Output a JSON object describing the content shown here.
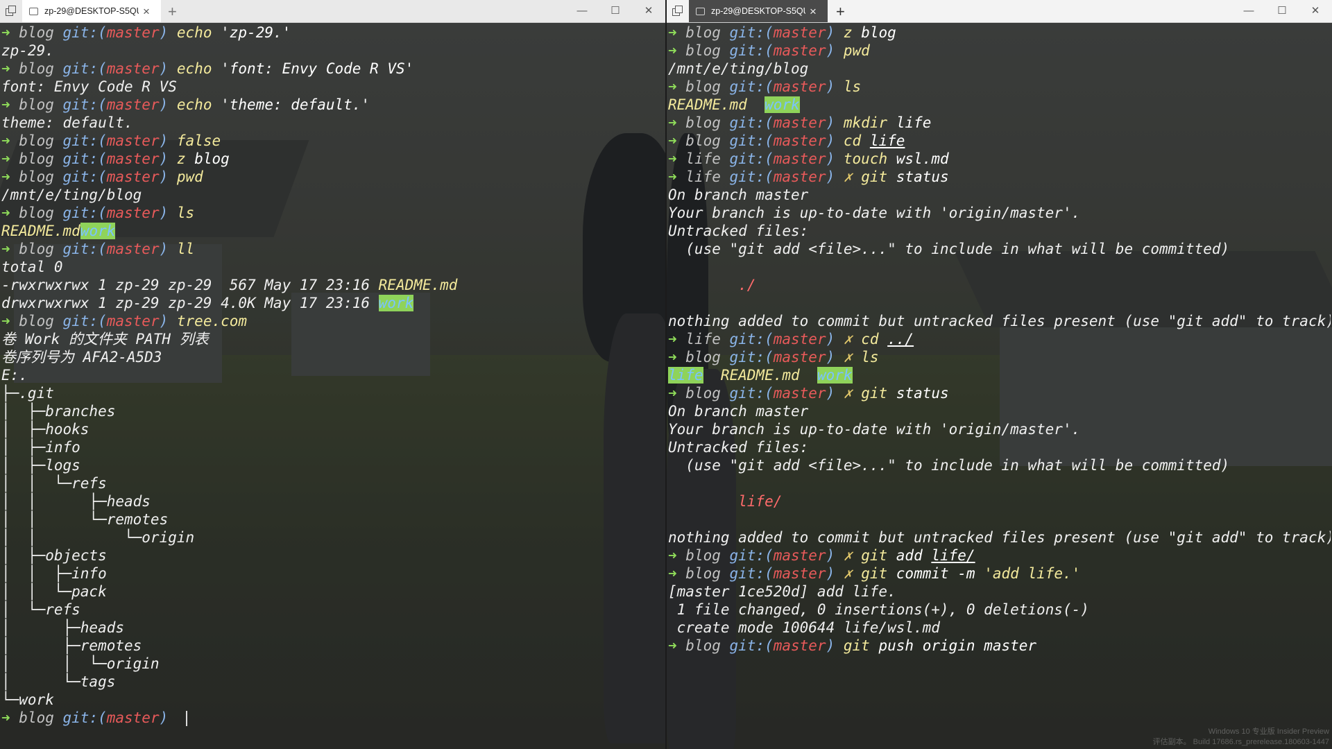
{
  "left": {
    "tab_title": "zp-29@DESKTOP-S5QU",
    "lines": [
      {
        "p": "blog",
        "cmd": "echo",
        "arg": "'zp-29.'"
      },
      {
        "o": "zp-29."
      },
      {
        "p": "blog",
        "cmd": "echo",
        "arg": "'font: Envy Code R VS'"
      },
      {
        "o": "font: Envy Code R VS"
      },
      {
        "p": "blog",
        "cmd": "echo",
        "arg": "'theme: default.'"
      },
      {
        "o": "theme: default."
      },
      {
        "p": "blog",
        "cmd": "false",
        "arg": ""
      },
      {
        "p": "blog",
        "cmd": "z",
        "arg": "blog"
      },
      {
        "p": "blog",
        "cmd": "pwd",
        "arg": ""
      },
      {
        "o": "/mnt/e/ting/blog"
      },
      {
        "p": "blog",
        "cmd": "ls",
        "arg": ""
      },
      {
        "o": "README.md",
        "o2": "work"
      },
      {
        "p": "blog",
        "cmd": "ll",
        "arg": ""
      },
      {
        "o": "total 0"
      },
      {
        "o": "-rwxrwxrwx 1 zp-29 zp-29  567 May 17 23:16 ",
        "o2": "README.md"
      },
      {
        "o": "drwxrwxrwx 1 zp-29 zp-29 4.0K May 17 23:16 ",
        "o2": "work"
      },
      {
        "p": "blog",
        "cmd": "tree.com",
        "arg": ""
      },
      {
        "o": "卷 Work 的文件夹 PATH 列表"
      },
      {
        "o": "卷序列号为 AFA2-A5D3"
      },
      {
        "o": "E:."
      },
      {
        "o": "├─.git"
      },
      {
        "o": "│  ├─branches"
      },
      {
        "o": "│  ├─hooks"
      },
      {
        "o": "│  ├─info"
      },
      {
        "o": "│  ├─logs"
      },
      {
        "o": "│  │  └─refs"
      },
      {
        "o": "│  │      ├─heads"
      },
      {
        "o": "│  │      └─remotes"
      },
      {
        "o": "│  │          └─origin"
      },
      {
        "o": "│  ├─objects"
      },
      {
        "o": "│  │  ├─info"
      },
      {
        "o": "│  │  └─pack"
      },
      {
        "o": "│  └─refs"
      },
      {
        "o": "│      ├─heads"
      },
      {
        "o": "│      ├─remotes"
      },
      {
        "o": "│      │  └─origin"
      },
      {
        "o": "│      └─tags"
      },
      {
        "o": "└─work"
      },
      {
        "p": "blog",
        "cmd": "",
        "arg": "",
        "cursor": true
      }
    ]
  },
  "right": {
    "tab_title": "zp-29@DESKTOP-S5QU",
    "lines": [
      {
        "p": "blog",
        "cmd": "z",
        "arg": "blog"
      },
      {
        "p": "blog",
        "cmd": "pwd",
        "arg": ""
      },
      {
        "o": "/mnt/e/ting/blog"
      },
      {
        "p": "blog",
        "cmd": "ls",
        "arg": ""
      },
      {
        "o": "README.md  ",
        "o2": "work"
      },
      {
        "p": "blog",
        "cmd": "mkdir",
        "arg": "life"
      },
      {
        "p": "blog",
        "cmd": "cd",
        "arg": "life",
        "underline": true
      },
      {
        "p": "life",
        "cmd": "touch",
        "arg": "wsl.md"
      },
      {
        "p": "life",
        "x": true,
        "cmd": "git",
        "arg": "status"
      },
      {
        "o": "On branch master"
      },
      {
        "o": "Your branch is up-to-date with 'origin/master'."
      },
      {
        "o": "Untracked files:"
      },
      {
        "o": "  (use \"git add <file>...\" to include in what will be committed)"
      },
      {
        "o": ""
      },
      {
        "red": "        ./"
      },
      {
        "o": ""
      },
      {
        "o": "nothing added to commit but untracked files present (use \"git add\" to track)"
      },
      {
        "p": "life",
        "x": true,
        "cmd": "cd",
        "arg": "../",
        "underline": true
      },
      {
        "p": "blog",
        "x": true,
        "cmd": "ls",
        "arg": ""
      },
      {
        "hl1": "life",
        "mid": "  README.md  ",
        "hl2": "work"
      },
      {
        "p": "blog",
        "x": true,
        "cmd": "git",
        "arg": "status"
      },
      {
        "o": "On branch master"
      },
      {
        "o": "Your branch is up-to-date with 'origin/master'."
      },
      {
        "o": "Untracked files:"
      },
      {
        "o": "  (use \"git add <file>...\" to include in what will be committed)"
      },
      {
        "o": ""
      },
      {
        "red": "        life/"
      },
      {
        "o": ""
      },
      {
        "o": "nothing added to commit but untracked files present (use \"git add\" to track)"
      },
      {
        "p": "blog",
        "x": true,
        "cmd": "git",
        "arg": "add",
        "arg2": "life/"
      },
      {
        "p": "blog",
        "x": true,
        "cmd": "git",
        "arg": "commit -m",
        "str": "'add life.'"
      },
      {
        "o": "[master 1ce520d] add life."
      },
      {
        "o": " 1 file changed, 0 insertions(+), 0 deletions(-)"
      },
      {
        "o": " create mode 100644 life/wsl.md"
      },
      {
        "p": "blog",
        "cmd": "git",
        "arg": "push origin master"
      }
    ]
  },
  "prompt": {
    "arrow": "➜",
    "git": "git:(",
    "branch": "master",
    "close": ")",
    "x": "✗"
  },
  "watermark": {
    "line1": "Windows 10 专业版 Insider Preview",
    "line2": "评估副本。 Build 17686.rs_prerelease.180603-1447"
  },
  "icons": {
    "tab": "terminal-icon",
    "close": "close-icon",
    "new": "plus-icon",
    "min": "minimize-icon",
    "max": "maximize-icon",
    "winclose": "close-icon"
  }
}
